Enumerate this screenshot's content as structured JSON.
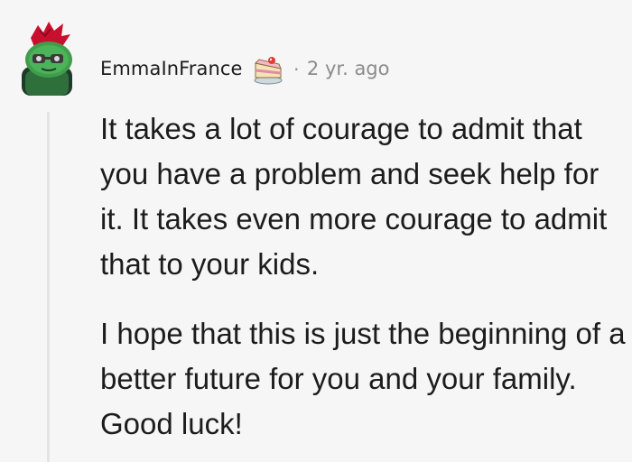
{
  "comment": {
    "username": "EmmaInFrance",
    "separator": "·",
    "timestamp": "2 yr. ago",
    "award_icon": "cake-award-icon",
    "avatar_icon": "snoo-avatar-icon",
    "paragraphs": [
      "It takes a lot of courage to admit that you have a problem and seek help for it. It takes even more courage to admit that to your kids.",
      "I hope that this is just the beginning of a better future for you and your family. Good luck!"
    ]
  },
  "colors": {
    "background": "#f6f6f6",
    "text": "#1c1c1c",
    "meta_text": "#8b8b8b",
    "thread_line": "#e4e4e4",
    "avatar_green": "#3f9e4a",
    "avatar_red": "#c8102e"
  }
}
